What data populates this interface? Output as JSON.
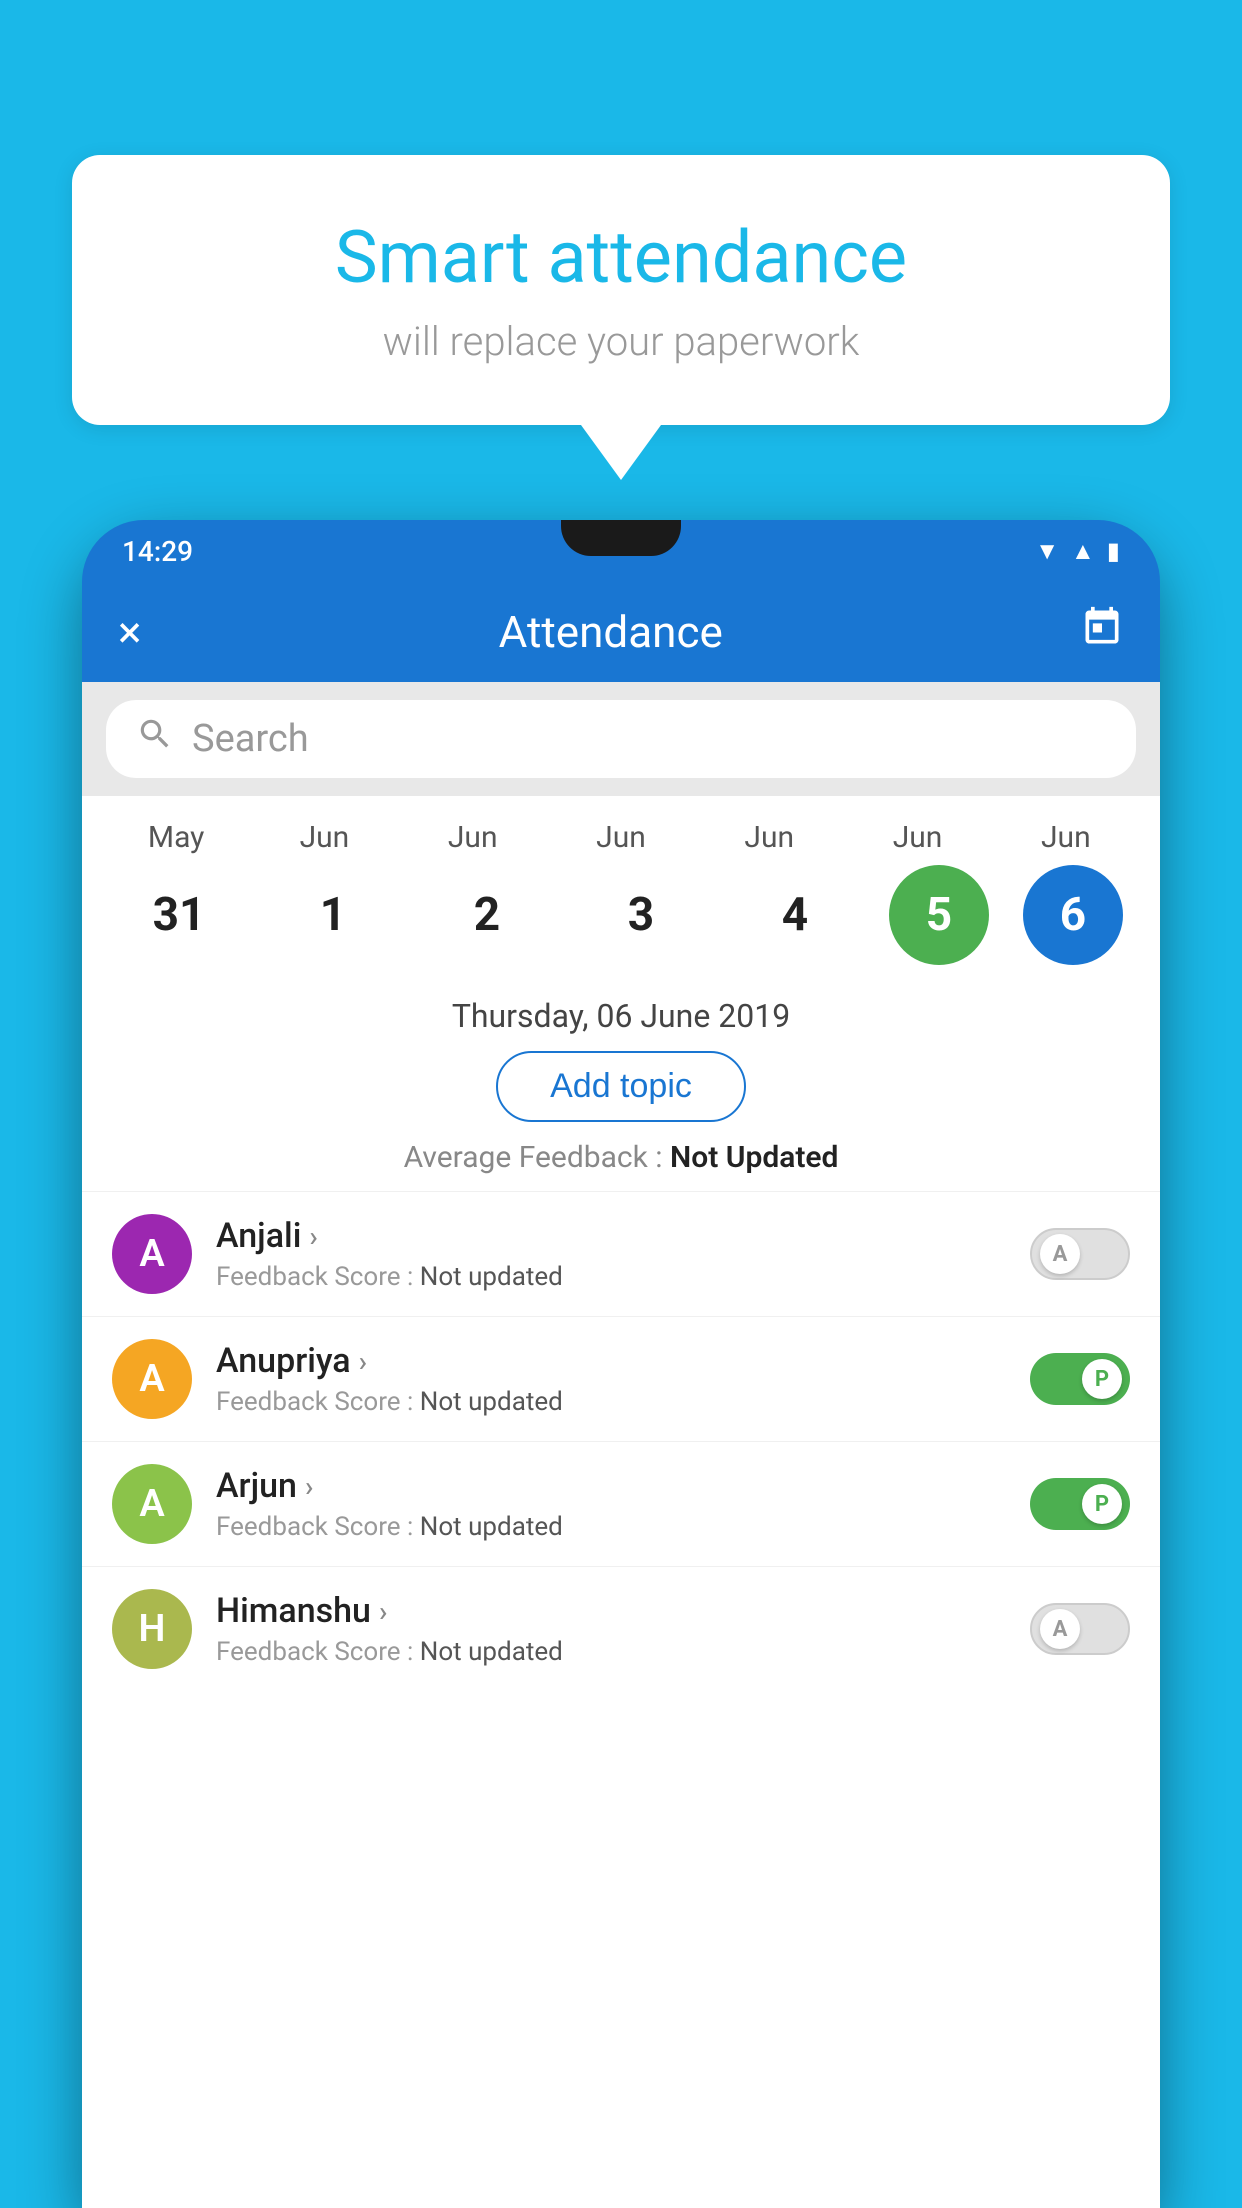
{
  "background_color": "#1ab8e8",
  "bubble": {
    "title": "Smart attendance",
    "subtitle": "will replace your paperwork"
  },
  "status_bar": {
    "time": "14:29",
    "icons": [
      "wifi",
      "signal",
      "battery"
    ]
  },
  "app_bar": {
    "title": "Attendance",
    "close_label": "×",
    "calendar_icon": "📅"
  },
  "search": {
    "placeholder": "Search"
  },
  "calendar": {
    "months": [
      "May",
      "Jun",
      "Jun",
      "Jun",
      "Jun",
      "Jun",
      "Jun"
    ],
    "dates": [
      "31",
      "1",
      "2",
      "3",
      "4",
      "5",
      "6"
    ],
    "today_index": 5,
    "selected_index": 6
  },
  "selected_date_label": "Thursday, 06 June 2019",
  "add_topic_label": "Add topic",
  "avg_feedback_label": "Average Feedback :",
  "avg_feedback_value": "Not Updated",
  "students": [
    {
      "name": "Anjali",
      "avatar_letter": "A",
      "avatar_color": "#9c27b0",
      "feedback_label": "Feedback Score :",
      "feedback_value": "Not updated",
      "toggle_state": "off",
      "toggle_letter": "A"
    },
    {
      "name": "Anupriya",
      "avatar_letter": "A",
      "avatar_color": "#f5a623",
      "feedback_label": "Feedback Score :",
      "feedback_value": "Not updated",
      "toggle_state": "on",
      "toggle_letter": "P"
    },
    {
      "name": "Arjun",
      "avatar_letter": "A",
      "avatar_color": "#8bc34a",
      "feedback_label": "Feedback Score :",
      "feedback_value": "Not updated",
      "toggle_state": "on",
      "toggle_letter": "P"
    },
    {
      "name": "Himanshu",
      "avatar_letter": "H",
      "avatar_color": "#aab84e",
      "feedback_label": "Feedback Score :",
      "feedback_value": "Not updated",
      "toggle_state": "off",
      "toggle_letter": "A"
    }
  ]
}
